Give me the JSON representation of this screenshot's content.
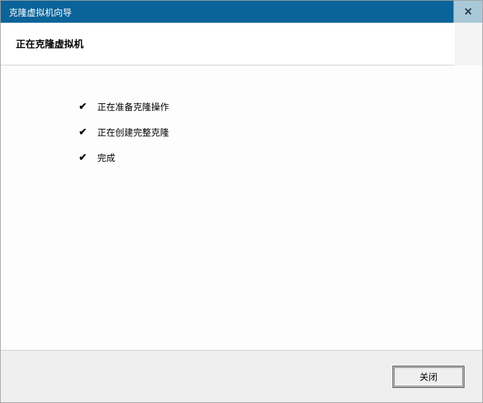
{
  "window": {
    "title": "克隆虚拟机向导"
  },
  "header": {
    "title": "正在克隆虚拟机"
  },
  "tasks": [
    {
      "label": "正在准备克隆操作"
    },
    {
      "label": "正在创建完整克隆"
    },
    {
      "label": "完成"
    }
  ],
  "footer": {
    "close_label": "关闭"
  }
}
